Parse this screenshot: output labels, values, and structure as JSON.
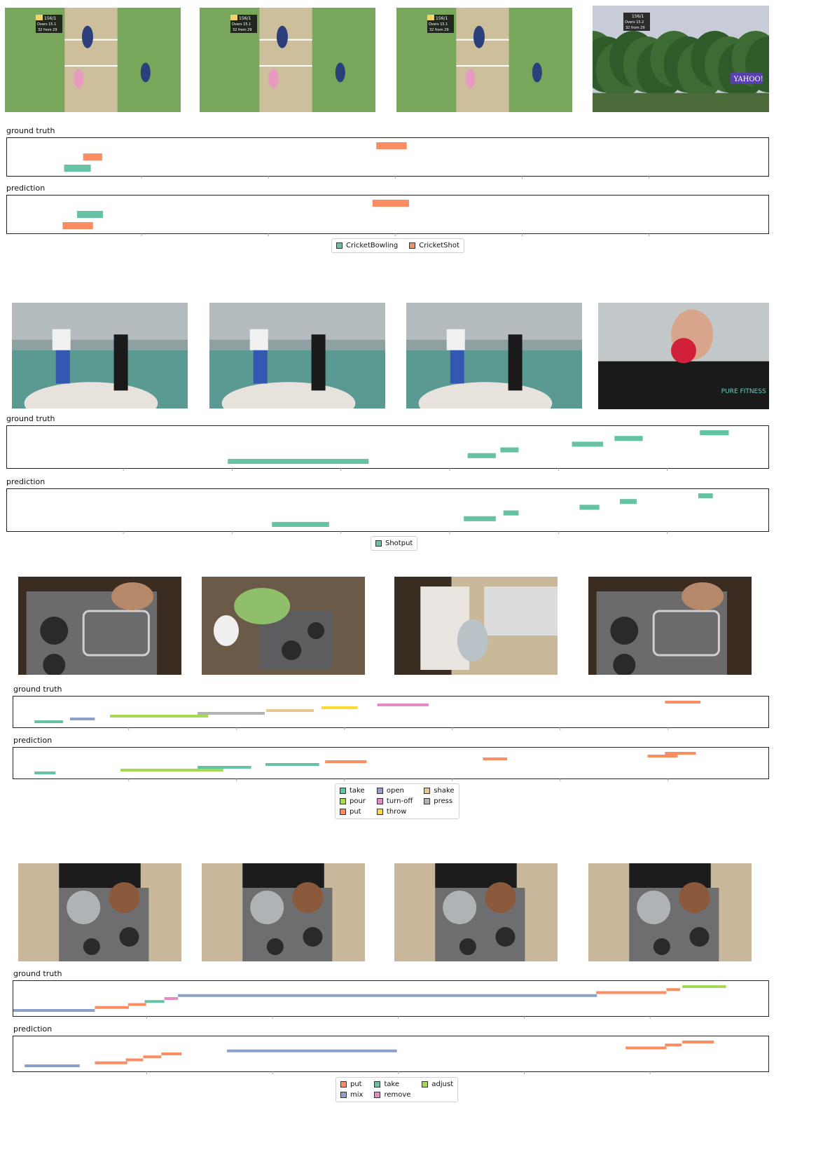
{
  "panels": [
    {
      "frames": [
        {
          "scene": "cricket",
          "score": "156/1",
          "overs": "15.1",
          "target": "32 from 29",
          "sponsor": ""
        },
        {
          "scene": "cricket",
          "score": "156/1",
          "overs": "15.1",
          "target": "32 from 29",
          "sponsor": ""
        },
        {
          "scene": "cricket",
          "score": "156/1",
          "overs": "15.1",
          "target": "32 from 29",
          "sponsor": ""
        },
        {
          "scene": "trees",
          "score": "156/1",
          "overs": "15.2",
          "target": "32 from 29",
          "sponsor": "YAHOO!"
        }
      ],
      "ground_truth_label": "ground truth",
      "prediction_label": "prediction",
      "legend": [
        {
          "label": "CricketBowling",
          "color": "#66c2a5"
        },
        {
          "label": "CricketShot",
          "color": "#fc8d62"
        }
      ]
    },
    {
      "frames": [
        {
          "scene": "shotput-two-women"
        },
        {
          "scene": "shotput-two-women"
        },
        {
          "scene": "shotput-two-women"
        },
        {
          "scene": "shotput-closeup",
          "shirt_text": "PURE FITNESS"
        }
      ],
      "ground_truth_label": "ground truth",
      "prediction_label": "prediction",
      "legend": [
        {
          "label": "Shotput",
          "color": "#66c2a5"
        }
      ]
    },
    {
      "frames": [
        {
          "scene": "kitchen-stove"
        },
        {
          "scene": "kitchen-greens"
        },
        {
          "scene": "kitchen-counter"
        },
        {
          "scene": "kitchen-stove"
        }
      ],
      "ground_truth_label": "ground truth",
      "prediction_label": "prediction",
      "legend": [
        {
          "label": "take",
          "color": "#66c2a5"
        },
        {
          "label": "pour",
          "color": "#a6d854"
        },
        {
          "label": "put",
          "color": "#fc8d62"
        },
        {
          "label": "open",
          "color": "#8da0cb"
        },
        {
          "label": "turn-off",
          "color": "#e78ac3"
        },
        {
          "label": "throw",
          "color": "#ffd92f"
        },
        {
          "label": "shake",
          "color": "#e5c494"
        },
        {
          "label": "press",
          "color": "#b3b3b3"
        }
      ]
    },
    {
      "frames": [
        {
          "scene": "kitchen-pots"
        },
        {
          "scene": "kitchen-pots"
        },
        {
          "scene": "kitchen-pots"
        },
        {
          "scene": "kitchen-pots"
        }
      ],
      "ground_truth_label": "ground truth",
      "prediction_label": "prediction",
      "legend": [
        {
          "label": "put",
          "color": "#fc8d62"
        },
        {
          "label": "mix",
          "color": "#8da0cb"
        },
        {
          "label": "take",
          "color": "#66c2a5"
        },
        {
          "label": "remove",
          "color": "#e78ac3"
        },
        {
          "label": "adjust",
          "color": "#a6d854"
        }
      ]
    }
  ],
  "chart_data": [
    {
      "type": "timeline",
      "x_range": [
        0,
        100
      ],
      "categories": [
        "CricketBowling",
        "CricketShot"
      ],
      "ground_truth": [
        {
          "label": "CricketBowling",
          "start": 7.5,
          "end": 11.0,
          "lane": 0
        },
        {
          "label": "CricketShot",
          "start": 10.0,
          "end": 12.5,
          "lane": 1
        },
        {
          "label": "CricketShot",
          "start": 48.5,
          "end": 52.5,
          "lane": 2
        }
      ],
      "prediction": [
        {
          "label": "CricketShot",
          "start": 7.3,
          "end": 11.3,
          "lane": 0
        },
        {
          "label": "CricketBowling",
          "start": 9.2,
          "end": 12.6,
          "lane": 1
        },
        {
          "label": "CricketShot",
          "start": 48.0,
          "end": 52.8,
          "lane": 2
        }
      ]
    },
    {
      "type": "timeline",
      "x_range": [
        0,
        100
      ],
      "categories": [
        "Shotput"
      ],
      "ground_truth": [
        {
          "label": "Shotput",
          "start": 29.0,
          "end": 47.5,
          "lane": 0
        },
        {
          "label": "Shotput",
          "start": 60.5,
          "end": 64.2,
          "lane": 1
        },
        {
          "label": "Shotput",
          "start": 64.8,
          "end": 67.2,
          "lane": 2
        },
        {
          "label": "Shotput",
          "start": 74.2,
          "end": 78.3,
          "lane": 3
        },
        {
          "label": "Shotput",
          "start": 79.8,
          "end": 83.5,
          "lane": 4
        },
        {
          "label": "Shotput",
          "start": 91.0,
          "end": 94.8,
          "lane": 5
        }
      ],
      "prediction": [
        {
          "label": "Shotput",
          "start": 34.8,
          "end": 42.3,
          "lane": 0
        },
        {
          "label": "Shotput",
          "start": 60.0,
          "end": 64.2,
          "lane": 1
        },
        {
          "label": "Shotput",
          "start": 65.2,
          "end": 67.2,
          "lane": 2
        },
        {
          "label": "Shotput",
          "start": 75.2,
          "end": 77.8,
          "lane": 3
        },
        {
          "label": "Shotput",
          "start": 80.5,
          "end": 82.7,
          "lane": 4
        },
        {
          "label": "Shotput",
          "start": 90.8,
          "end": 92.7,
          "lane": 5
        }
      ]
    },
    {
      "type": "timeline",
      "x_range": [
        0,
        100
      ],
      "categories": [
        "take",
        "pour",
        "put",
        "open",
        "turn-off",
        "throw",
        "shake",
        "press"
      ],
      "ground_truth": [
        {
          "label": "take",
          "start": 2.8,
          "end": 6.6,
          "lane": 0
        },
        {
          "label": "open",
          "start": 7.5,
          "end": 10.8,
          "lane": 1
        },
        {
          "label": "pour",
          "start": 12.8,
          "end": 25.8,
          "lane": 2
        },
        {
          "label": "press",
          "start": 24.4,
          "end": 33.3,
          "lane": 3
        },
        {
          "label": "shake",
          "start": 33.5,
          "end": 39.8,
          "lane": 4
        },
        {
          "label": "throw",
          "start": 40.8,
          "end": 45.6,
          "lane": 5
        },
        {
          "label": "turn-off",
          "start": 48.2,
          "end": 55.0,
          "lane": 6
        },
        {
          "label": "put",
          "start": 86.3,
          "end": 91.0,
          "lane": 7
        }
      ],
      "prediction": [
        {
          "label": "take",
          "start": 2.8,
          "end": 5.6,
          "lane": 0
        },
        {
          "label": "pour",
          "start": 14.2,
          "end": 27.8,
          "lane": 1
        },
        {
          "label": "take",
          "start": 24.4,
          "end": 31.5,
          "lane": 2
        },
        {
          "label": "take",
          "start": 33.4,
          "end": 40.5,
          "lane": 3
        },
        {
          "label": "put",
          "start": 41.3,
          "end": 46.8,
          "lane": 4
        },
        {
          "label": "put",
          "start": 62.2,
          "end": 65.4,
          "lane": 5
        },
        {
          "label": "put",
          "start": 84.0,
          "end": 88.0,
          "lane": 6
        },
        {
          "label": "put",
          "start": 86.3,
          "end": 90.4,
          "lane": 7
        }
      ]
    },
    {
      "type": "timeline",
      "x_range": [
        0,
        100
      ],
      "categories": [
        "put",
        "mix",
        "take",
        "remove",
        "adjust"
      ],
      "ground_truth": [
        {
          "label": "mix",
          "start": 0.0,
          "end": 10.8,
          "lane": 0
        },
        {
          "label": "put",
          "start": 10.8,
          "end": 15.3,
          "lane": 1
        },
        {
          "label": "put",
          "start": 15.2,
          "end": 17.6,
          "lane": 2
        },
        {
          "label": "take",
          "start": 17.4,
          "end": 20.0,
          "lane": 3
        },
        {
          "label": "remove",
          "start": 20.0,
          "end": 21.8,
          "lane": 4
        },
        {
          "label": "mix",
          "start": 21.8,
          "end": 77.3,
          "lane": 5
        },
        {
          "label": "put",
          "start": 77.2,
          "end": 86.5,
          "lane": 6
        },
        {
          "label": "put",
          "start": 86.5,
          "end": 88.3,
          "lane": 7
        },
        {
          "label": "adjust",
          "start": 88.6,
          "end": 94.4,
          "lane": 8
        }
      ],
      "prediction": [
        {
          "label": "mix",
          "start": 1.5,
          "end": 8.8,
          "lane": 0
        },
        {
          "label": "put",
          "start": 10.8,
          "end": 15.1,
          "lane": 1
        },
        {
          "label": "put",
          "start": 14.9,
          "end": 17.2,
          "lane": 2
        },
        {
          "label": "put",
          "start": 17.2,
          "end": 19.6,
          "lane": 3
        },
        {
          "label": "put",
          "start": 19.6,
          "end": 22.3,
          "lane": 4
        },
        {
          "label": "mix",
          "start": 28.3,
          "end": 50.8,
          "lane": 5
        },
        {
          "label": "put",
          "start": 81.1,
          "end": 86.5,
          "lane": 6
        },
        {
          "label": "put",
          "start": 86.3,
          "end": 88.5,
          "lane": 7
        },
        {
          "label": "put",
          "start": 88.6,
          "end": 92.8,
          "lane": 8
        }
      ]
    }
  ]
}
